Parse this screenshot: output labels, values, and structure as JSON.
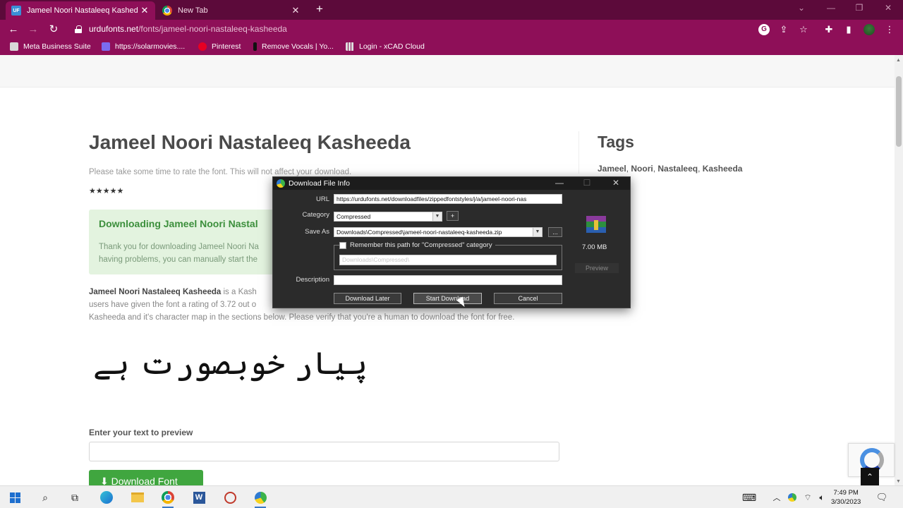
{
  "browser": {
    "tabs": [
      {
        "label": "Jameel Noori Nastaleeq Kashed",
        "favicon": "UF",
        "active": true
      },
      {
        "label": "New Tab",
        "active": false
      }
    ],
    "url_host": "urdufonts.net",
    "url_path": "/fonts/jameel-noori-nastaleeq-kasheeda",
    "accent_color": "#8e0f58",
    "bookmarks": [
      {
        "label": "Meta Business Suite"
      },
      {
        "label": "https://solarmovies...."
      },
      {
        "label": "Pinterest"
      },
      {
        "label": "Remove Vocals | Yo..."
      },
      {
        "label": "Login - xCAD Cloud"
      }
    ]
  },
  "page": {
    "title": "Jameel Noori Nastaleeq Kasheeda",
    "rate_prompt": "Please take some time to rate the font. This will not affect your download.",
    "stars": "★★★★★",
    "alert": {
      "title": "Downloading Jameel Noori Nastal",
      "line1": "Thank you for downloading Jameel Noori Na",
      "line2": "having problems, you can manually start the"
    },
    "desc": {
      "font_name": "Jameel Noori Nastaleeq Kasheeda",
      "line1_rest": " is a Kash",
      "line2": "users have given the font a rating of 3.72 out o",
      "line3": "Kasheeda and it's character map in the sections below. Please verify that you're a human to download the font for free."
    },
    "urdu_sample": "پیار خوبصورت ہے",
    "preview_label": "Enter your text to preview",
    "download_button": "Download Font",
    "tags_title": "Tags",
    "tags": [
      "Jameel",
      "Noori",
      "Nastaleeq",
      "Kasheeda"
    ]
  },
  "dialog": {
    "title": "Download File Info",
    "url_label": "URL",
    "url_value": "https://urdufonts.net/downloadfiles/zippedfontstyles/j/a/jameel-noori-nas",
    "category_label": "Category",
    "category_value": "Compressed",
    "save_as_label": "Save As",
    "save_as_value": "Downloads\\Compressed\\jameel-noori-nastaleeq-kasheeda.zip",
    "remember_label": "Remember this path for \"Compressed\" category",
    "remember_value": "Downloads\\Compressed\\",
    "description_label": "Description",
    "description_value": "",
    "file_size": "7.00  MB",
    "preview_label": "Preview",
    "add_button": "+",
    "browse_button": "...",
    "btn_later": "Download Later",
    "btn_start": "Start Download",
    "btn_cancel": "Cancel"
  },
  "taskbar": {
    "time": "7:49 PM",
    "date": "3/30/2023"
  }
}
